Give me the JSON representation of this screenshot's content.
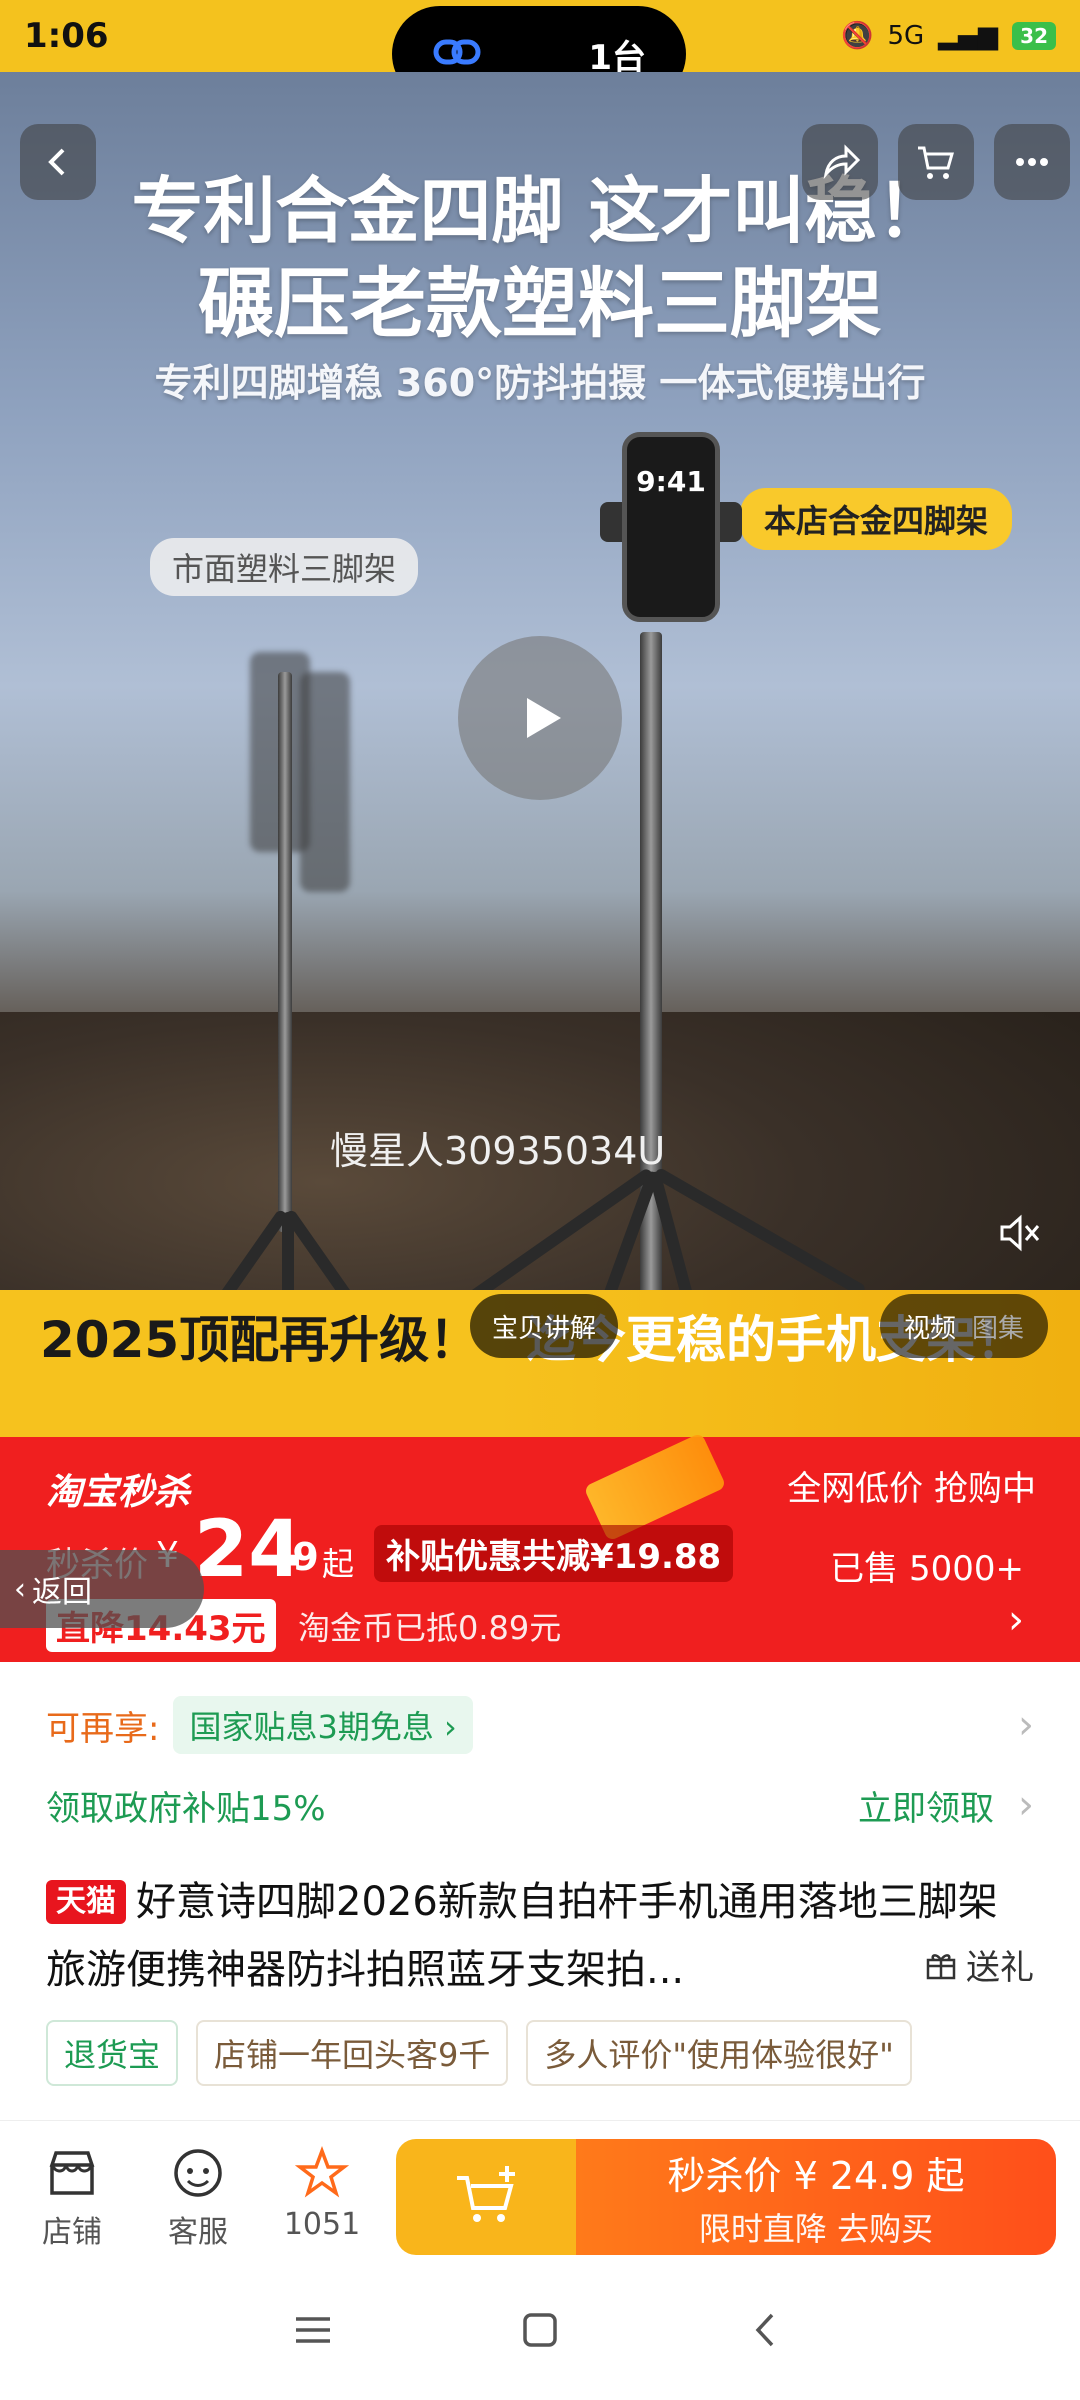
{
  "status_bar": {
    "time": "1:06",
    "island_label": "1台",
    "battery": "32",
    "network": "5G"
  },
  "hero": {
    "title_line1": "专利合金四脚 这才叫稳！",
    "title_line2": "碾压老款塑料三脚架",
    "subtitle": "专利四脚增稳 360°防抖拍摄 一体式便携出行",
    "tag_left": "市面塑料三脚架",
    "tag_right": "本店合金四脚架",
    "phone_time": "9:41",
    "watermark": "慢星人30935034U",
    "banner_left": "2025顶配再升级！",
    "banner_right": "迄今更稳的手机支架！",
    "media_tab_explain": "宝贝讲解",
    "media_tab_video": "视频",
    "media_tab_gallery": "图集"
  },
  "flash_sale": {
    "brand": "淘宝秒杀",
    "low_price": "全网低价 抢购中",
    "seckill_label": "秒杀价",
    "currency": "¥",
    "price_int": "24",
    "price_dec": ".9",
    "price_suffix": "起",
    "subsidy": "补贴优惠共减¥19.88",
    "sold": "已售 5000+",
    "drop": "直降14.43元",
    "coin": "淘金币已抵0.89元"
  },
  "back_float": {
    "label": "返回"
  },
  "benefits": {
    "label": "可再享:",
    "pill": "国家贴息3期免息 ›",
    "gov_label": "领取政府补贴15%",
    "gov_claim": "立即领取"
  },
  "product": {
    "badge": "天猫",
    "title": "好意诗四脚2026新款自拍杆手机通用落地三脚架旅游便携神器防抖拍照蓝牙支架拍...",
    "gift": "送礼"
  },
  "tags": [
    "退货宝",
    "店铺一年回头客9千",
    "多人评价\"使用体验很好\""
  ],
  "action_bar": {
    "store": "店铺",
    "service": "客服",
    "favorites": "1051",
    "buy_line1": "秒杀价 ¥ 24.9 起",
    "buy_line2": "限时直降 去购买"
  },
  "colors": {
    "accent_yellow": "#f4c21e",
    "sale_red": "#f01f1f",
    "green": "#1d9b53",
    "orange": "#ff6a1a"
  }
}
